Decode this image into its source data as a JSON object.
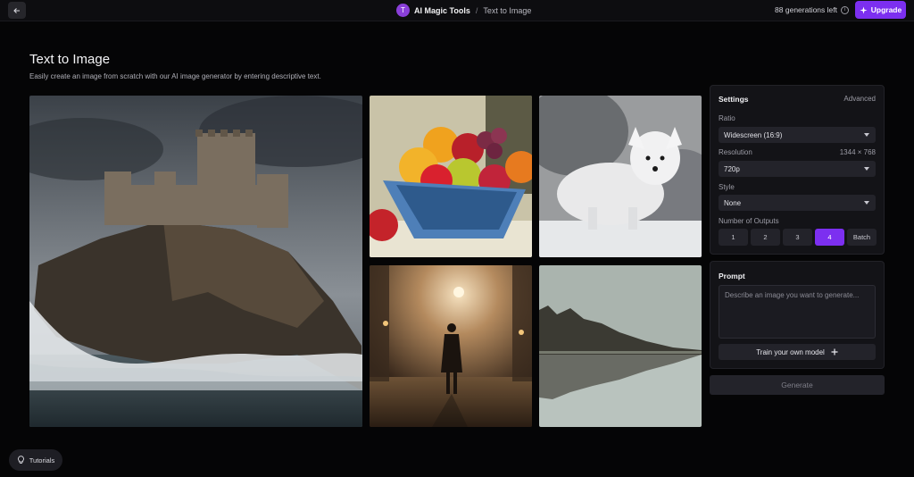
{
  "header": {
    "avatar_initial": "T",
    "app_name": "AI Magic Tools",
    "separator": "/",
    "page_name": "Text to Image",
    "generations_left": "88 generations left",
    "upgrade_label": "Upgrade"
  },
  "main": {
    "title": "Text to Image",
    "subtitle": "Easily create an image from scratch with our AI image generator by entering descriptive text."
  },
  "settings": {
    "title": "Settings",
    "advanced_label": "Advanced",
    "ratio_label": "Ratio",
    "ratio_value": "Widescreen (16:9)",
    "resolution_label": "Resolution",
    "resolution_dims": "1344 × 768",
    "resolution_value": "720p",
    "style_label": "Style",
    "style_value": "None",
    "outputs_label": "Number of Outputs",
    "outputs": [
      "1",
      "2",
      "3",
      "4",
      "Batch"
    ],
    "selected_output": "4"
  },
  "prompt": {
    "title": "Prompt",
    "placeholder": "Describe an image you want to generate...",
    "train_label": "Train your own model",
    "train_icon": "plus-icon"
  },
  "generate_label": "Generate",
  "tutorials_label": "Tutorials",
  "colors": {
    "accent": "#7c2ff0",
    "background": "#050506",
    "panel": "#131317"
  }
}
